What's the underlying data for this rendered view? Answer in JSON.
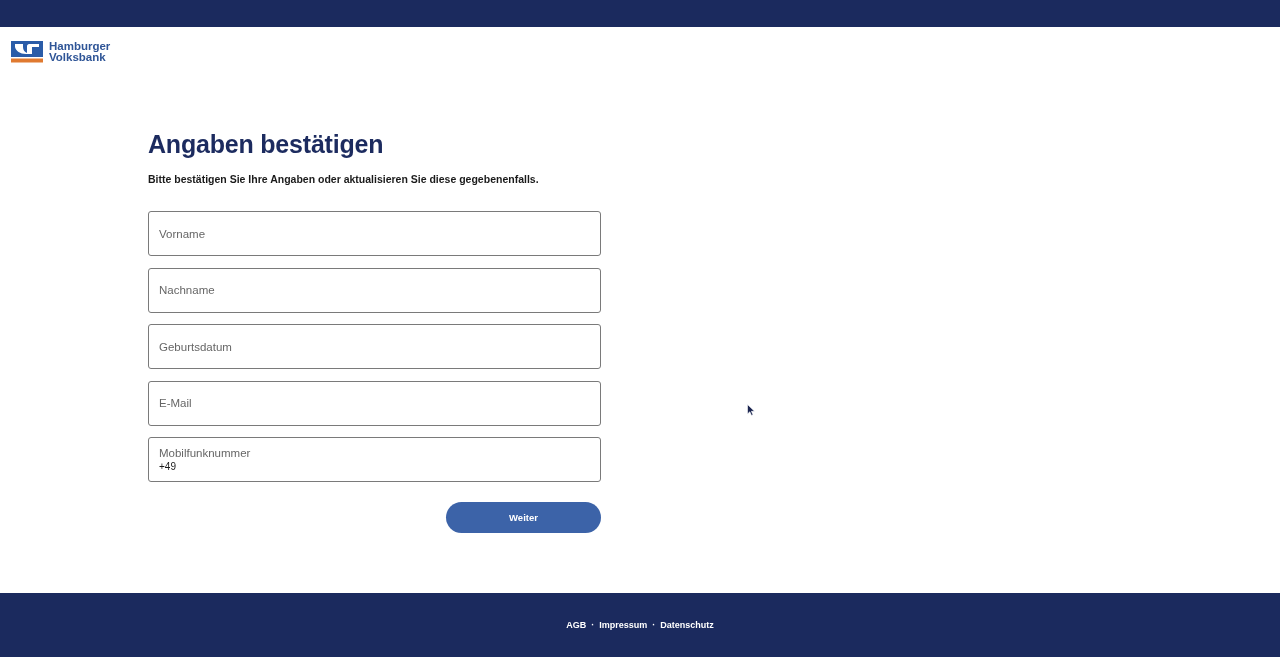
{
  "brand": {
    "name_lines": [
      "Hamburger",
      "Volksbank"
    ]
  },
  "heading": "Angaben bestätigen",
  "intro": "Bitte bestätigen Sie Ihre Angaben oder aktualisieren Sie diese gegebenenfalls.",
  "fields": [
    {
      "kind": "empty",
      "placeholder": "Vorname"
    },
    {
      "kind": "empty",
      "placeholder": "Nachname"
    },
    {
      "kind": "empty",
      "placeholder": "Geburtsdatum"
    },
    {
      "kind": "empty",
      "placeholder": "E-Mail"
    },
    {
      "kind": "filled",
      "label": "Mobilfunknummer",
      "value": "+49"
    }
  ],
  "submit_button": "Weiter",
  "footer": {
    "links": [
      "AGB",
      "Impressum",
      "Datenschutz"
    ],
    "separators": [
      "·",
      "·"
    ]
  }
}
